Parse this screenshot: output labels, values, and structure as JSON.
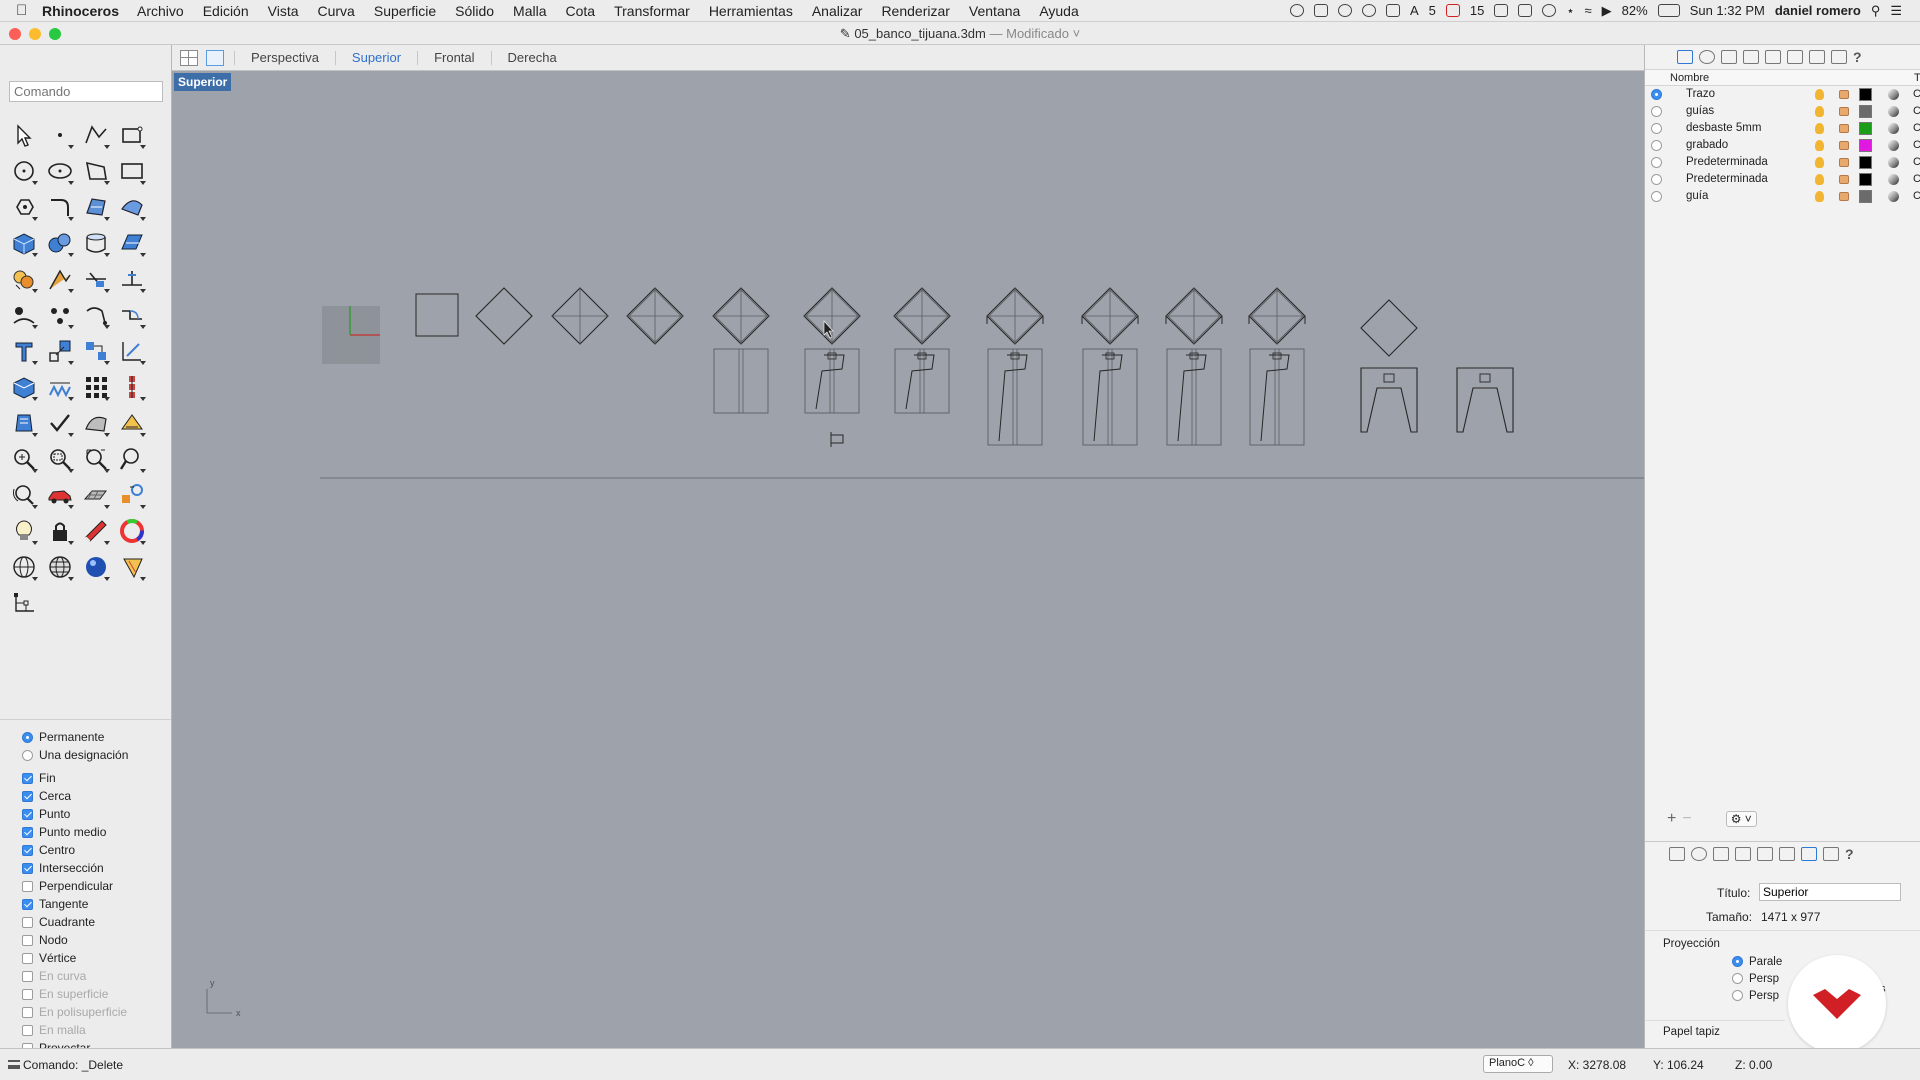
{
  "menubar": {
    "app_name": "Rhinoceros",
    "items": [
      "Archivo",
      "Edición",
      "Vista",
      "Curva",
      "Superficie",
      "Sólido",
      "Malla",
      "Cota",
      "Transformar",
      "Herramientas",
      "Analizar",
      "Renderizar",
      "Ventana",
      "Ayuda"
    ],
    "status_count_a": "5",
    "status_count_b": "15",
    "battery": "82%",
    "clock": "Sun 1:32 PM",
    "user": "daniel romero"
  },
  "window": {
    "title": "05_banco_tijuana.3dm",
    "state": "— Modificado ˅"
  },
  "command": {
    "placeholder": "Comando"
  },
  "viewport_tabs": [
    "Perspectiva",
    "Superior",
    "Frontal",
    "Derecha"
  ],
  "viewport": {
    "active_label": "Superior",
    "axis_y": "y",
    "axis_x": "x"
  },
  "tools": [
    "select-arrow",
    "point",
    "polyline",
    "rectangle-curve",
    "circle",
    "ellipse",
    "polygon",
    "rectangle",
    "curve-offset",
    "fillet",
    "surface-edge",
    "surface-patch",
    "box-solid",
    "sphere",
    "cylinder",
    "extrude-surface",
    "boolean",
    "explode",
    "split",
    "trim",
    "group",
    "join",
    "rebuild",
    "chamfer",
    "text",
    "scale",
    "align",
    "project",
    "solid-tools",
    "array-linear",
    "array-grid",
    "array-polar",
    "analyze",
    "check",
    "mesh",
    "render-mesh",
    "zoom-extents",
    "zoom-window",
    "zoom-selected",
    "zoom",
    "rotate-view",
    "car",
    "layout",
    "snap",
    "light",
    "lock",
    "material",
    "color-wheel",
    "globe-wire",
    "globe-shaded",
    "render-sphere",
    "cone",
    "history"
  ],
  "osnap": {
    "mode_items": [
      {
        "label": "Permanente",
        "on": true
      },
      {
        "label": "Una designación",
        "on": false
      }
    ],
    "snaps": [
      {
        "label": "Fin",
        "on": true,
        "enabled": true
      },
      {
        "label": "Cerca",
        "on": true,
        "enabled": true
      },
      {
        "label": "Punto",
        "on": true,
        "enabled": true
      },
      {
        "label": "Punto medio",
        "on": true,
        "enabled": true
      },
      {
        "label": "Centro",
        "on": true,
        "enabled": true
      },
      {
        "label": "Intersección",
        "on": true,
        "enabled": true
      },
      {
        "label": "Perpendicular",
        "on": false,
        "enabled": true
      },
      {
        "label": "Tangente",
        "on": true,
        "enabled": true
      },
      {
        "label": "Cuadrante",
        "on": false,
        "enabled": true
      },
      {
        "label": "Nodo",
        "on": false,
        "enabled": true
      },
      {
        "label": "Vértice",
        "on": false,
        "enabled": true
      },
      {
        "label": "En curva",
        "on": false,
        "enabled": false
      },
      {
        "label": "En superficie",
        "on": false,
        "enabled": false
      },
      {
        "label": "En polisuperficie",
        "on": false,
        "enabled": false
      },
      {
        "label": "En malla",
        "on": false,
        "enabled": false
      },
      {
        "label": "Proyectar",
        "on": false,
        "enabled": true
      }
    ]
  },
  "layers": {
    "header_name": "Nombre",
    "header_t": "T",
    "rows": [
      {
        "name": "Trazo",
        "current": true,
        "color": "#000000"
      },
      {
        "name": "guías",
        "current": false,
        "color": "#6b6b6b"
      },
      {
        "name": "desbaste 5mm",
        "current": false,
        "color": "#1a9e1a"
      },
      {
        "name": "grabado",
        "current": false,
        "color": "#e019e0"
      },
      {
        "name": "Predeterminada",
        "current": false,
        "color": "#000000"
      },
      {
        "name": "Predeterminada",
        "current": false,
        "color": "#000000"
      },
      {
        "name": "guía",
        "current": false,
        "color": "#6b6b6b"
      }
    ],
    "add_label": "+",
    "remove_label": "−",
    "gear_label": "⚙ ˅"
  },
  "properties": {
    "title_label": "Título:",
    "title_value": "Superior",
    "size_label": "Tamaño:",
    "size_value": "1471 x 977",
    "projection_label": "Proyección",
    "projection_options": [
      {
        "label": "Parale",
        "on": true
      },
      {
        "label": "Persp",
        "on": false
      },
      {
        "label": "Persp",
        "on": false
      }
    ],
    "trailing_text": "os",
    "wallpaper_label": "Papel tapiz"
  },
  "status": {
    "command_text": "Comando: _Delete",
    "plane": "PlanoC ◊",
    "x": "X: 3278.08",
    "y": "Y: 106.24",
    "z": "Z: 0.00"
  },
  "colors": {
    "viewport_bg": "#9ea3ab",
    "accent": "#3b8ef0",
    "viewport_label_bg": "#3e6ea8",
    "vitra_red": "#d01f25"
  }
}
